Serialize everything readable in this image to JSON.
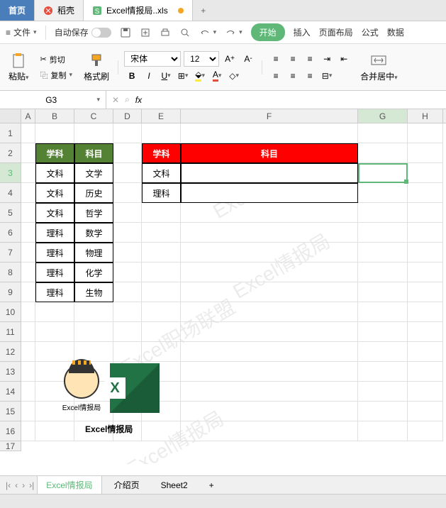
{
  "titlebar": {
    "home": "首页",
    "dao": "稻壳",
    "file": "Excel情报局..xls"
  },
  "menu": {
    "file": "文件",
    "autosave": "自动保存",
    "start": "开始",
    "insert": "插入",
    "page": "页面布局",
    "formula": "公式",
    "data": "数据"
  },
  "ribbon": {
    "cut": "剪切",
    "paste": "粘贴",
    "copy": "复制",
    "format": "格式刷",
    "font": "宋体",
    "size": "12",
    "merge": "合并居中"
  },
  "namebox": "G3",
  "columns": [
    "A",
    "B",
    "C",
    "D",
    "E",
    "F",
    "G",
    "H"
  ],
  "rows": [
    "1",
    "2",
    "3",
    "4",
    "5",
    "6",
    "7",
    "8",
    "9",
    "10",
    "11",
    "12",
    "13",
    "14",
    "15",
    "16",
    "17"
  ],
  "table1": {
    "header": [
      "学科",
      "科目"
    ],
    "rows": [
      [
        "文科",
        "文学"
      ],
      [
        "文科",
        "历史"
      ],
      [
        "文科",
        "哲学"
      ],
      [
        "理科",
        "数学"
      ],
      [
        "理科",
        "物理"
      ],
      [
        "理科",
        "化学"
      ],
      [
        "理科",
        "生物"
      ]
    ]
  },
  "table2": {
    "header": [
      "学科",
      "科目"
    ],
    "rows": [
      [
        "文科",
        ""
      ],
      [
        "理科",
        ""
      ]
    ]
  },
  "logos": {
    "cap1": "Excel情报局",
    "cap2": "Excel情报局"
  },
  "sheets": {
    "s1": "Excel情报局",
    "s2": "介绍页",
    "s3": "Sheet2"
  },
  "watermarks": [
    "Excel职场联盟",
    "Excel情报局",
    "Excel职场联盟",
    "Excel情报局"
  ]
}
